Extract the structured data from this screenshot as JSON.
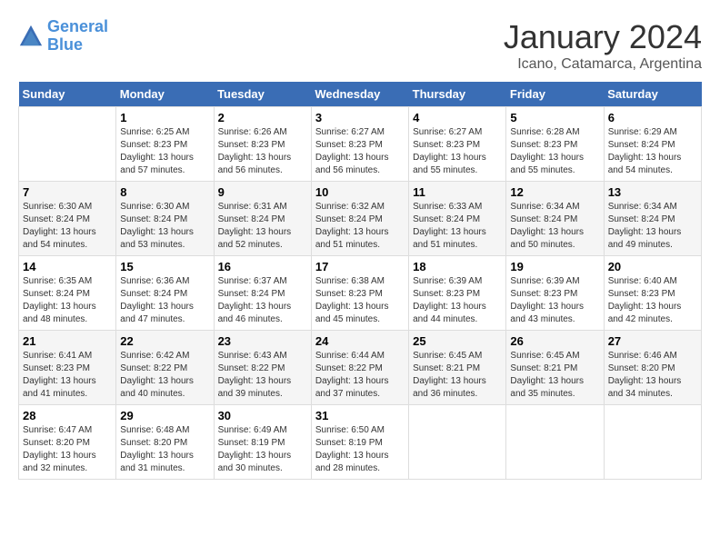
{
  "header": {
    "logo_line1": "General",
    "logo_line2": "Blue",
    "month_year": "January 2024",
    "location": "Icano, Catamarca, Argentina"
  },
  "weekdays": [
    "Sunday",
    "Monday",
    "Tuesday",
    "Wednesday",
    "Thursday",
    "Friday",
    "Saturday"
  ],
  "weeks": [
    [
      {
        "day": "",
        "sunrise": "",
        "sunset": "",
        "daylight": ""
      },
      {
        "day": "1",
        "sunrise": "Sunrise: 6:25 AM",
        "sunset": "Sunset: 8:23 PM",
        "daylight": "Daylight: 13 hours and 57 minutes."
      },
      {
        "day": "2",
        "sunrise": "Sunrise: 6:26 AM",
        "sunset": "Sunset: 8:23 PM",
        "daylight": "Daylight: 13 hours and 56 minutes."
      },
      {
        "day": "3",
        "sunrise": "Sunrise: 6:27 AM",
        "sunset": "Sunset: 8:23 PM",
        "daylight": "Daylight: 13 hours and 56 minutes."
      },
      {
        "day": "4",
        "sunrise": "Sunrise: 6:27 AM",
        "sunset": "Sunset: 8:23 PM",
        "daylight": "Daylight: 13 hours and 55 minutes."
      },
      {
        "day": "5",
        "sunrise": "Sunrise: 6:28 AM",
        "sunset": "Sunset: 8:23 PM",
        "daylight": "Daylight: 13 hours and 55 minutes."
      },
      {
        "day": "6",
        "sunrise": "Sunrise: 6:29 AM",
        "sunset": "Sunset: 8:24 PM",
        "daylight": "Daylight: 13 hours and 54 minutes."
      }
    ],
    [
      {
        "day": "7",
        "sunrise": "Sunrise: 6:30 AM",
        "sunset": "Sunset: 8:24 PM",
        "daylight": "Daylight: 13 hours and 54 minutes."
      },
      {
        "day": "8",
        "sunrise": "Sunrise: 6:30 AM",
        "sunset": "Sunset: 8:24 PM",
        "daylight": "Daylight: 13 hours and 53 minutes."
      },
      {
        "day": "9",
        "sunrise": "Sunrise: 6:31 AM",
        "sunset": "Sunset: 8:24 PM",
        "daylight": "Daylight: 13 hours and 52 minutes."
      },
      {
        "day": "10",
        "sunrise": "Sunrise: 6:32 AM",
        "sunset": "Sunset: 8:24 PM",
        "daylight": "Daylight: 13 hours and 51 minutes."
      },
      {
        "day": "11",
        "sunrise": "Sunrise: 6:33 AM",
        "sunset": "Sunset: 8:24 PM",
        "daylight": "Daylight: 13 hours and 51 minutes."
      },
      {
        "day": "12",
        "sunrise": "Sunrise: 6:34 AM",
        "sunset": "Sunset: 8:24 PM",
        "daylight": "Daylight: 13 hours and 50 minutes."
      },
      {
        "day": "13",
        "sunrise": "Sunrise: 6:34 AM",
        "sunset": "Sunset: 8:24 PM",
        "daylight": "Daylight: 13 hours and 49 minutes."
      }
    ],
    [
      {
        "day": "14",
        "sunrise": "Sunrise: 6:35 AM",
        "sunset": "Sunset: 8:24 PM",
        "daylight": "Daylight: 13 hours and 48 minutes."
      },
      {
        "day": "15",
        "sunrise": "Sunrise: 6:36 AM",
        "sunset": "Sunset: 8:24 PM",
        "daylight": "Daylight: 13 hours and 47 minutes."
      },
      {
        "day": "16",
        "sunrise": "Sunrise: 6:37 AM",
        "sunset": "Sunset: 8:24 PM",
        "daylight": "Daylight: 13 hours and 46 minutes."
      },
      {
        "day": "17",
        "sunrise": "Sunrise: 6:38 AM",
        "sunset": "Sunset: 8:23 PM",
        "daylight": "Daylight: 13 hours and 45 minutes."
      },
      {
        "day": "18",
        "sunrise": "Sunrise: 6:39 AM",
        "sunset": "Sunset: 8:23 PM",
        "daylight": "Daylight: 13 hours and 44 minutes."
      },
      {
        "day": "19",
        "sunrise": "Sunrise: 6:39 AM",
        "sunset": "Sunset: 8:23 PM",
        "daylight": "Daylight: 13 hours and 43 minutes."
      },
      {
        "day": "20",
        "sunrise": "Sunrise: 6:40 AM",
        "sunset": "Sunset: 8:23 PM",
        "daylight": "Daylight: 13 hours and 42 minutes."
      }
    ],
    [
      {
        "day": "21",
        "sunrise": "Sunrise: 6:41 AM",
        "sunset": "Sunset: 8:23 PM",
        "daylight": "Daylight: 13 hours and 41 minutes."
      },
      {
        "day": "22",
        "sunrise": "Sunrise: 6:42 AM",
        "sunset": "Sunset: 8:22 PM",
        "daylight": "Daylight: 13 hours and 40 minutes."
      },
      {
        "day": "23",
        "sunrise": "Sunrise: 6:43 AM",
        "sunset": "Sunset: 8:22 PM",
        "daylight": "Daylight: 13 hours and 39 minutes."
      },
      {
        "day": "24",
        "sunrise": "Sunrise: 6:44 AM",
        "sunset": "Sunset: 8:22 PM",
        "daylight": "Daylight: 13 hours and 37 minutes."
      },
      {
        "day": "25",
        "sunrise": "Sunrise: 6:45 AM",
        "sunset": "Sunset: 8:21 PM",
        "daylight": "Daylight: 13 hours and 36 minutes."
      },
      {
        "day": "26",
        "sunrise": "Sunrise: 6:45 AM",
        "sunset": "Sunset: 8:21 PM",
        "daylight": "Daylight: 13 hours and 35 minutes."
      },
      {
        "day": "27",
        "sunrise": "Sunrise: 6:46 AM",
        "sunset": "Sunset: 8:20 PM",
        "daylight": "Daylight: 13 hours and 34 minutes."
      }
    ],
    [
      {
        "day": "28",
        "sunrise": "Sunrise: 6:47 AM",
        "sunset": "Sunset: 8:20 PM",
        "daylight": "Daylight: 13 hours and 32 minutes."
      },
      {
        "day": "29",
        "sunrise": "Sunrise: 6:48 AM",
        "sunset": "Sunset: 8:20 PM",
        "daylight": "Daylight: 13 hours and 31 minutes."
      },
      {
        "day": "30",
        "sunrise": "Sunrise: 6:49 AM",
        "sunset": "Sunset: 8:19 PM",
        "daylight": "Daylight: 13 hours and 30 minutes."
      },
      {
        "day": "31",
        "sunrise": "Sunrise: 6:50 AM",
        "sunset": "Sunset: 8:19 PM",
        "daylight": "Daylight: 13 hours and 28 minutes."
      },
      {
        "day": "",
        "sunrise": "",
        "sunset": "",
        "daylight": ""
      },
      {
        "day": "",
        "sunrise": "",
        "sunset": "",
        "daylight": ""
      },
      {
        "day": "",
        "sunrise": "",
        "sunset": "",
        "daylight": ""
      }
    ]
  ]
}
